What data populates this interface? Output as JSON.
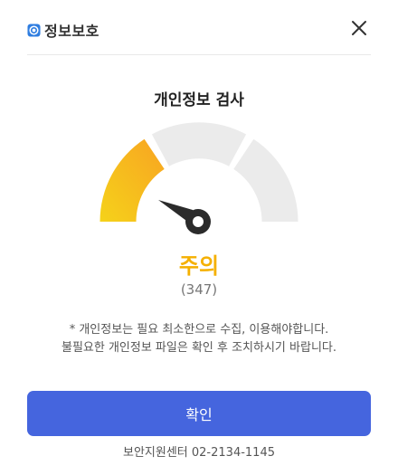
{
  "header": {
    "title": "정보보호",
    "brand_icon": "shield-icon",
    "close_icon": "close-icon"
  },
  "check": {
    "title": "개인정보 검사",
    "status": "주의",
    "score": "(347)",
    "risk_level_fraction": 0.33
  },
  "notice": {
    "line1": "* 개인정보는 필요 최소한으로 수집, 이용해야합니다.",
    "line2": "불필요한 개인정보 파일은 확인 후 조치하시기 바랍니다."
  },
  "actions": {
    "confirm_label": "확인"
  },
  "footer": {
    "support_text": "보안지원센터 02-2134-1145"
  },
  "colors": {
    "accent": "#4565de",
    "warning": "#f5b000",
    "gauge_active_start": "#f5d21a",
    "gauge_active_end": "#f8a422",
    "gauge_inactive": "#ebebeb",
    "needle": "#2b2b2b"
  }
}
